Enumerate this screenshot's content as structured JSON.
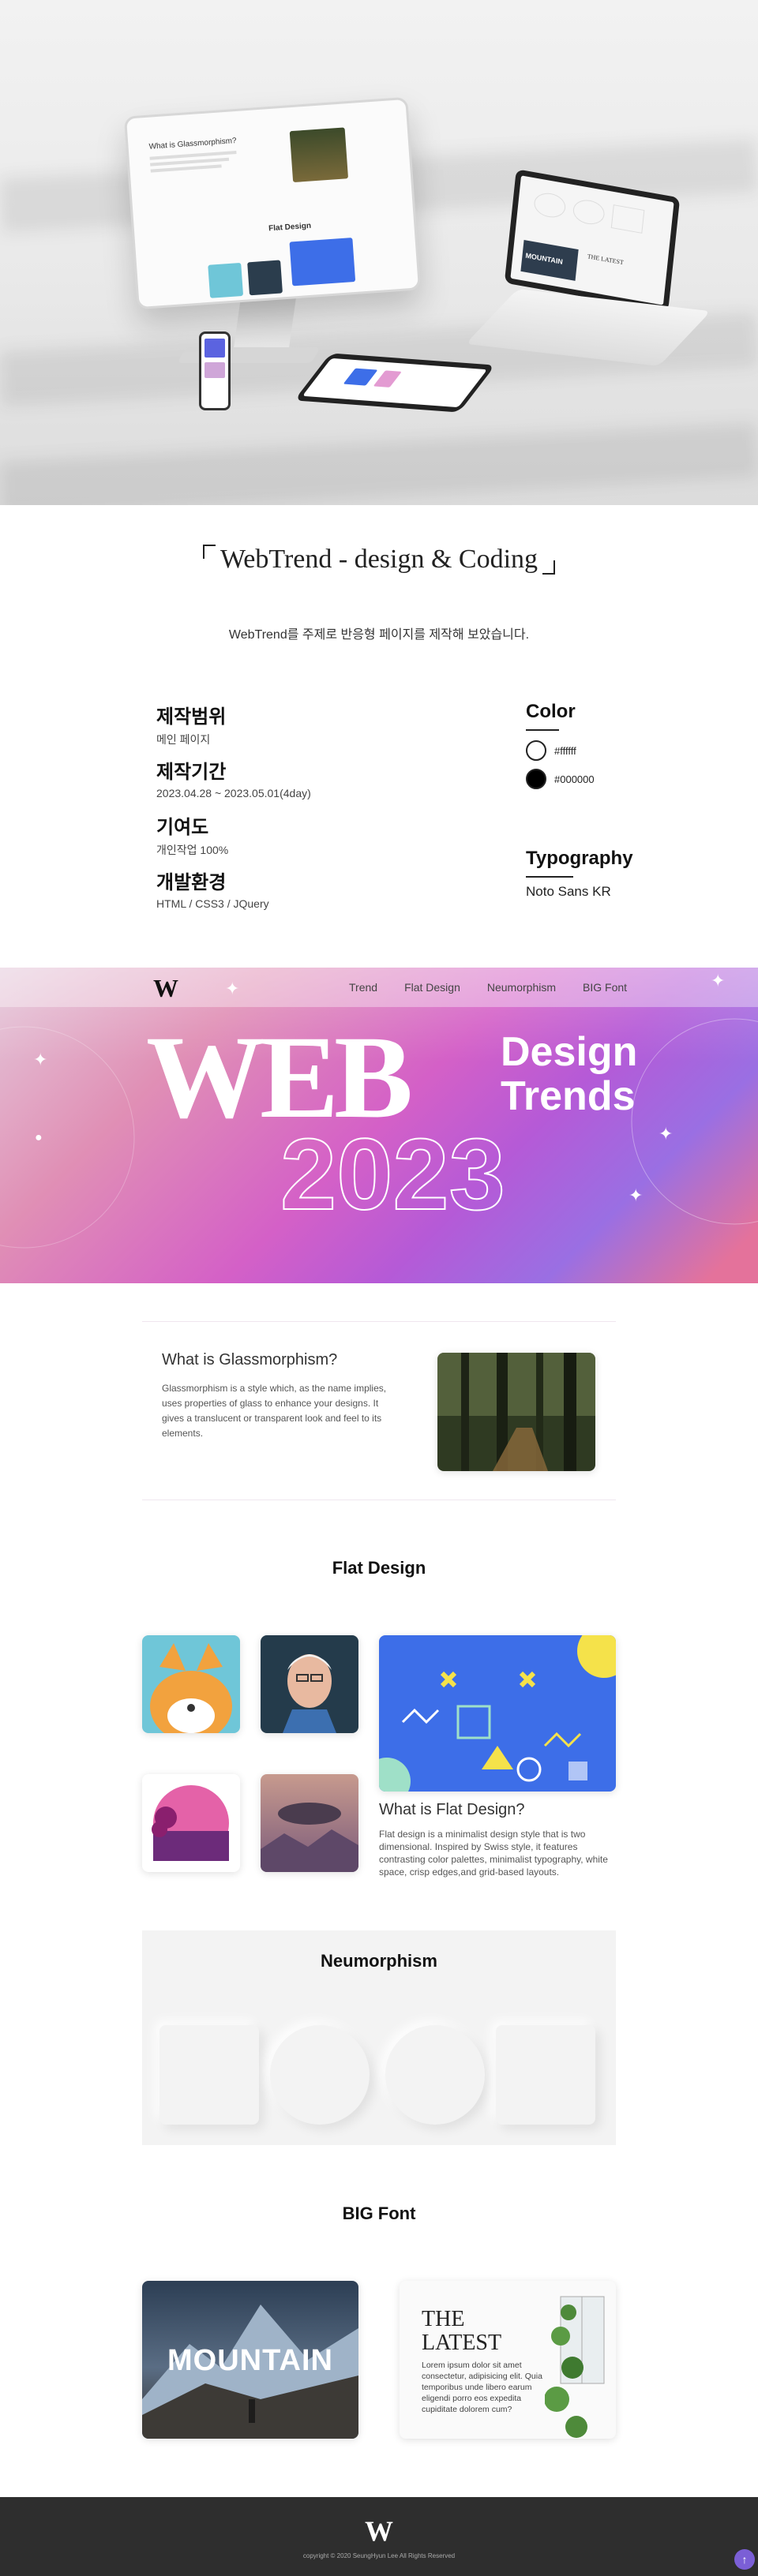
{
  "project": {
    "title": "WebTrend - design & Coding",
    "subtitle": "WebTrend를 주제로 반응형 페이지를 제작해 보았습니다.",
    "scope_label": "제작범위",
    "scope_value": "메인 페이지",
    "period_label": "제작기간",
    "period_value": "2023.04.28 ~ 2023.05.01(4day)",
    "contribution_label": "기여도",
    "contribution_value": "개인작업 100%",
    "env_label": "개발환경",
    "env_value": "HTML / CSS3 / JQuery",
    "color_label": "Color",
    "colors": [
      {
        "hex": "#ffffff",
        "label": "#ffffff"
      },
      {
        "hex": "#000000",
        "label": "#000000"
      }
    ],
    "typography_label": "Typography",
    "typography_value": "Noto Sans KR"
  },
  "site": {
    "logo": "W",
    "nav": [
      "Trend",
      "Flat Design",
      "Neumorphism",
      "BIG Font"
    ],
    "hero": {
      "web": "WEB",
      "design": "Design",
      "trends": "Trends",
      "year": "2023"
    },
    "glass": {
      "title": "What is Glassmorphism?",
      "body": "Glassmorphism is a style which, as the name implies, uses properties of glass to enhance your designs. It gives a translucent or transparent look and feel to its elements."
    },
    "flat": {
      "section_title": "Flat Design",
      "title": "What is Flat Design?",
      "body": "Flat design is a minimalist design style that is two dimensional. Inspired by Swiss style, it features contrasting color palettes, minimalist typography, white space, crisp edges,and grid-based layouts."
    },
    "neumorphism": {
      "section_title": "Neumorphism"
    },
    "bigfont": {
      "section_title": "BIG Font",
      "mountain": "MOUNTAIN",
      "latest_title": "THE LATEST",
      "latest_body": "Lorem ipsum dolor sit amet consectetur, adipisicing elit. Quia temporibus unde libero earum eligendi porro eos expedita cupiditate dolorem cum?"
    },
    "footer": {
      "logo": "W",
      "copyright": "copyright © 2020 SeungHyun Lee All Rights Reserved"
    }
  },
  "mockup": {
    "monitor_heading": "What is Glassmorphism?",
    "monitor_section": "Flat Design",
    "laptop_text": "MOUNTAIN",
    "laptop_text2": "THE LATEST"
  }
}
